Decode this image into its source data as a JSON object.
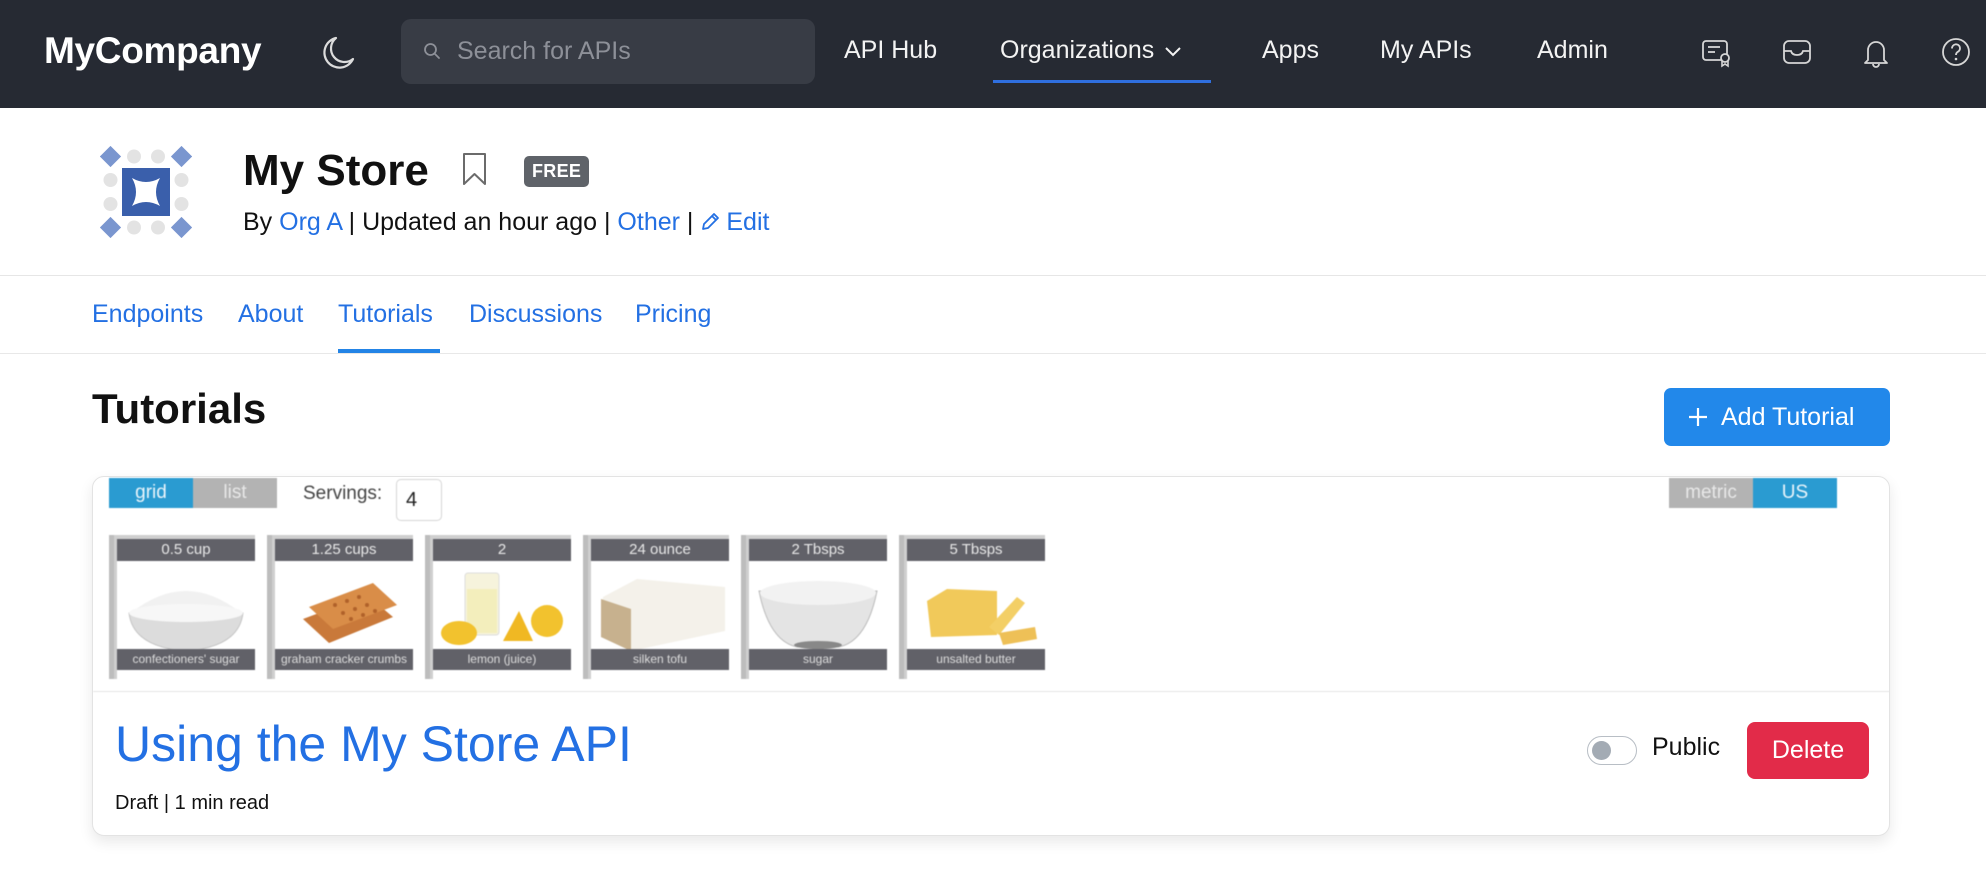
{
  "topnav": {
    "brand": "MyCompany",
    "theme_icon": "moon-icon",
    "search": {
      "placeholder": "Search for APIs",
      "value": "",
      "icon": "search-icon"
    },
    "links": [
      {
        "label": "API Hub",
        "active": false
      },
      {
        "label": "Organizations",
        "active": true,
        "has_dropdown": true
      },
      {
        "label": "Apps",
        "active": false
      },
      {
        "label": "My APIs",
        "active": false
      },
      {
        "label": "Admin",
        "active": false
      }
    ],
    "icons": [
      "certificate-icon",
      "inbox-icon",
      "bell-icon",
      "help-icon"
    ],
    "accent": "#2f6fdf",
    "background": "#262a33"
  },
  "api": {
    "title": "My Store",
    "badge": "FREE",
    "by_label": "By",
    "org": "Org A",
    "updated": "Updated an hour ago",
    "category": "Other",
    "edit_label": "Edit",
    "separator": "|"
  },
  "tabs": [
    {
      "label": "Endpoints",
      "active": false
    },
    {
      "label": "About",
      "active": false
    },
    {
      "label": "Tutorials",
      "active": true
    },
    {
      "label": "Discussions",
      "active": false
    },
    {
      "label": "Pricing",
      "active": false
    }
  ],
  "section": {
    "title": "Tutorials",
    "add_button": "Add Tutorial"
  },
  "tutorial": {
    "preview": {
      "view_toggle": [
        {
          "label": "grid",
          "active": true
        },
        {
          "label": "list",
          "active": false
        }
      ],
      "servings_label": "Servings:",
      "servings_value": "4",
      "unit_toggle": [
        {
          "label": "metric",
          "active": false
        },
        {
          "label": "US",
          "active": true
        }
      ],
      "ingredients": [
        {
          "qty": "0.5 cup",
          "name": "confectioners' sugar"
        },
        {
          "qty": "1.25 cups",
          "name": "graham cracker crumbs"
        },
        {
          "qty": "2",
          "name": "lemon (juice)"
        },
        {
          "qty": "24 ounce",
          "name": "silken tofu"
        },
        {
          "qty": "2 Tbsps",
          "name": "sugar"
        },
        {
          "qty": "5 Tbsps",
          "name": "unsalted butter"
        }
      ]
    },
    "title": "Using the My Store API",
    "meta": "Draft | 1 min read",
    "public_label": "Public",
    "public_on": false,
    "delete_label": "Delete",
    "delete_color": "#e22b49",
    "link_color": "#2370e3"
  }
}
